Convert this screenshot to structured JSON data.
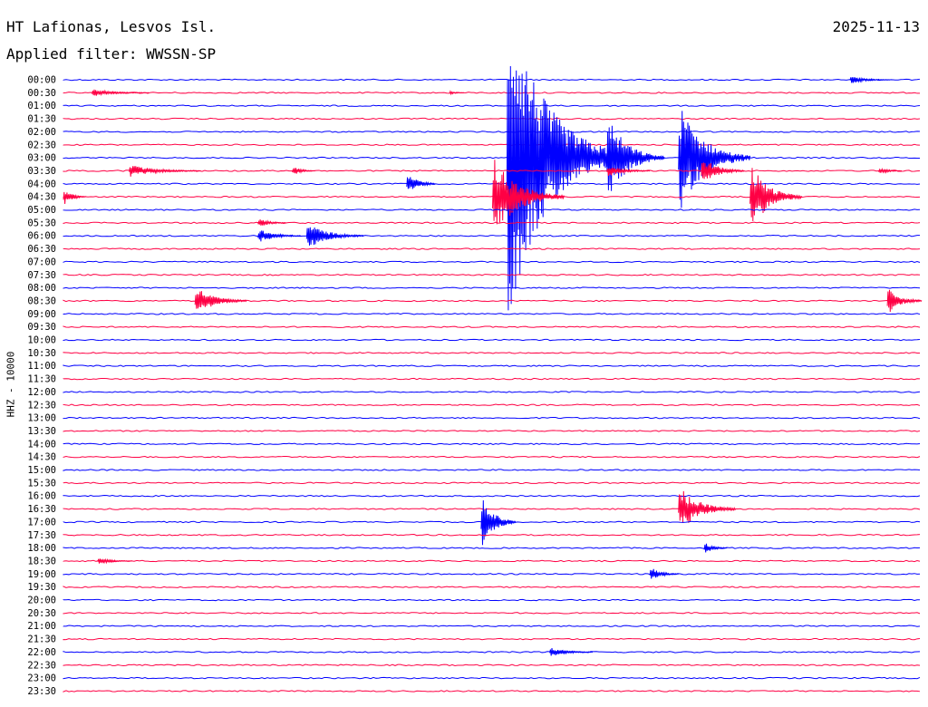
{
  "header": {
    "station": "HT Lafionas, Lesvos Isl.",
    "date": "2025-11-13",
    "filter_label": "Applied filter: WWSSN-SP"
  },
  "axis": {
    "ylabel": "HHZ - 10000"
  },
  "colors": {
    "trace_a": "#0000ff",
    "trace_b": "#ff0044"
  },
  "chart_data": {
    "type": "helicorder",
    "title": "HT Lafionas, Lesvos Isl.",
    "ylabel": "HHZ - 10000",
    "row_labels": [
      "00:00",
      "00:30",
      "01:00",
      "01:30",
      "02:00",
      "02:30",
      "03:00",
      "03:30",
      "04:00",
      "04:30",
      "05:00",
      "05:30",
      "06:00",
      "06:30",
      "07:00",
      "07:30",
      "08:00",
      "08:30",
      "09:00",
      "09:30",
      "10:00",
      "10:30",
      "11:00",
      "11:30",
      "12:00",
      "12:30",
      "13:00",
      "13:30",
      "14:00",
      "14:30",
      "15:00",
      "15:30",
      "16:00",
      "16:30",
      "17:00",
      "17:30",
      "18:00",
      "18:30",
      "19:00",
      "19:30",
      "20:00",
      "20:30",
      "21:00",
      "21:30",
      "22:00",
      "22:30",
      "23:00",
      "23:30"
    ],
    "row_minutes": 30,
    "events": [
      {
        "row": 0,
        "minute": 27.5,
        "amplitude": 0.3,
        "duration_min": 1.5
      },
      {
        "row": 1,
        "minute": 1.0,
        "amplitude": 0.3,
        "duration_min": 2.0
      },
      {
        "row": 1,
        "minute": 13.5,
        "amplitude": 0.2,
        "duration_min": 0.5
      },
      {
        "row": 6,
        "minute": 15.5,
        "amplitude": 13.0,
        "duration_min": 4.0
      },
      {
        "row": 6,
        "minute": 19.0,
        "amplitude": 3.5,
        "duration_min": 2.0
      },
      {
        "row": 6,
        "minute": 21.5,
        "amplitude": 4.5,
        "duration_min": 2.5
      },
      {
        "row": 7,
        "minute": 2.3,
        "amplitude": 0.5,
        "duration_min": 2.5
      },
      {
        "row": 7,
        "minute": 8.0,
        "amplitude": 0.4,
        "duration_min": 0.8
      },
      {
        "row": 7,
        "minute": 19.0,
        "amplitude": 0.5,
        "duration_min": 1.5
      },
      {
        "row": 7,
        "minute": 22.3,
        "amplitude": 1.2,
        "duration_min": 1.5
      },
      {
        "row": 7,
        "minute": 28.5,
        "amplitude": 0.3,
        "duration_min": 0.8
      },
      {
        "row": 8,
        "minute": 12.0,
        "amplitude": 1.0,
        "duration_min": 1.0
      },
      {
        "row": 9,
        "minute": 0.0,
        "amplitude": 0.7,
        "duration_min": 0.8
      },
      {
        "row": 9,
        "minute": 15.0,
        "amplitude": 3.2,
        "duration_min": 2.5
      },
      {
        "row": 9,
        "minute": 24.0,
        "amplitude": 2.8,
        "duration_min": 1.8
      },
      {
        "row": 11,
        "minute": 6.8,
        "amplitude": 0.4,
        "duration_min": 1.0
      },
      {
        "row": 12,
        "minute": 6.8,
        "amplitude": 0.6,
        "duration_min": 1.5
      },
      {
        "row": 12,
        "minute": 8.5,
        "amplitude": 1.1,
        "duration_min": 2.0
      },
      {
        "row": 17,
        "minute": 4.6,
        "amplitude": 1.2,
        "duration_min": 1.8
      },
      {
        "row": 17,
        "minute": 28.8,
        "amplitude": 1.2,
        "duration_min": 1.2
      },
      {
        "row": 34,
        "minute": 14.6,
        "amplitude": 2.3,
        "duration_min": 1.2
      },
      {
        "row": 33,
        "minute": 21.5,
        "amplitude": 1.9,
        "duration_min": 2.0
      },
      {
        "row": 36,
        "minute": 22.4,
        "amplitude": 0.5,
        "duration_min": 0.8
      },
      {
        "row": 37,
        "minute": 1.2,
        "amplitude": 0.3,
        "duration_min": 1.2
      },
      {
        "row": 38,
        "minute": 20.5,
        "amplitude": 0.6,
        "duration_min": 1.0
      },
      {
        "row": 44,
        "minute": 17.0,
        "amplitude": 0.4,
        "duration_min": 1.5
      }
    ]
  }
}
